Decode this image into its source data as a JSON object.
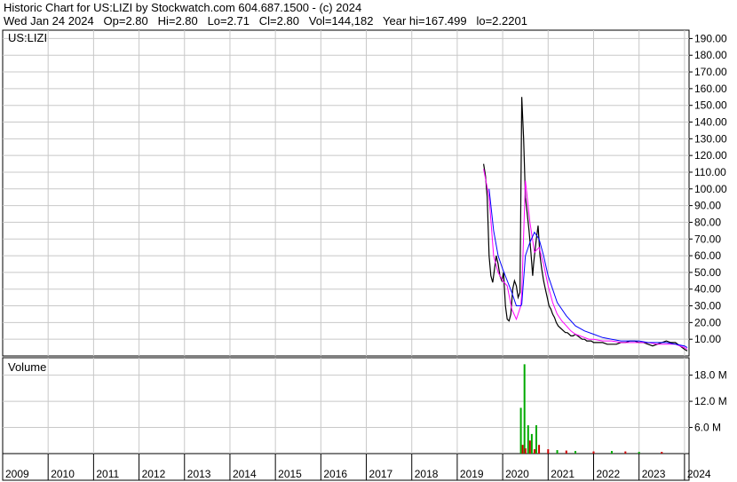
{
  "header": {
    "line1": "Historic Chart for US:LIZI by Stockwatch.com 604.687.1500 - (c) 2024",
    "line2": "Wed Jan 24 2024   Op=2.80   Hi=2.80   Lo=2.71   Cl=2.80   Vol=144,182   Year hi=167.499   lo=2.2201"
  },
  "chart_data": [
    {
      "type": "line",
      "symbol_label": "US:LIZI",
      "x_label": "",
      "y_label": "",
      "ylim": [
        0,
        195
      ],
      "yticks": [
        10,
        20,
        30,
        40,
        50,
        60,
        70,
        80,
        90,
        100,
        110,
        120,
        130,
        140,
        150,
        160,
        170,
        180,
        190
      ],
      "ytick_labels": [
        "10.00",
        "20.00",
        "30.00",
        "40.00",
        "50.00",
        "60.00",
        "70.00",
        "80.00",
        "90.00",
        "100.00",
        "110.00",
        "120.00",
        "130.00",
        "140.00",
        "150.00",
        "160.00",
        "170.00",
        "180.00",
        "190.00"
      ],
      "grid": true,
      "colors": {
        "price": "#000000",
        "ma_short": "#ff00ff",
        "ma_long": "#0000ff"
      },
      "series": [
        {
          "role": "price",
          "x": [
            2019.58,
            2019.62,
            2019.66,
            2019.7,
            2019.74,
            2019.78,
            2019.82,
            2019.86,
            2019.9,
            2019.94,
            2019.98,
            2020.02,
            2020.06,
            2020.1,
            2020.14,
            2020.18,
            2020.22,
            2020.26,
            2020.3,
            2020.34,
            2020.38,
            2020.42,
            2020.46,
            2020.5,
            2020.54,
            2020.58,
            2020.62,
            2020.66,
            2020.68,
            2020.7,
            2020.74,
            2020.78,
            2020.82,
            2020.86,
            2020.9,
            2020.94,
            2020.98,
            2021.02,
            2021.06,
            2021.1,
            2021.14,
            2021.18,
            2021.22,
            2021.26,
            2021.3,
            2021.34,
            2021.38,
            2021.42,
            2021.46,
            2021.5,
            2021.55,
            2021.6,
            2021.65,
            2021.7,
            2021.75,
            2021.8,
            2021.85,
            2021.9,
            2021.95,
            2022.0,
            2022.1,
            2022.2,
            2022.3,
            2022.4,
            2022.5,
            2022.6,
            2022.7,
            2022.8,
            2022.9,
            2023.0,
            2023.1,
            2023.2,
            2023.3,
            2023.4,
            2023.5,
            2023.6,
            2023.7,
            2023.8,
            2023.9,
            2024.0,
            2024.06
          ],
          "y": [
            115,
            108,
            95,
            60,
            48,
            44,
            52,
            60,
            55,
            48,
            45,
            50,
            30,
            22,
            21,
            25,
            40,
            45,
            42,
            35,
            38,
            155,
            130,
            95,
            85,
            75,
            62,
            48,
            55,
            60,
            70,
            78,
            60,
            52,
            45,
            40,
            35,
            30,
            28,
            25,
            23,
            20,
            18,
            17,
            16,
            15,
            14,
            14,
            13,
            12,
            12,
            13,
            12,
            11,
            10,
            10,
            9,
            9,
            9,
            8,
            8,
            8,
            7,
            7,
            7,
            8,
            8,
            9,
            9,
            8,
            8,
            7,
            6,
            7,
            8,
            9,
            8,
            8,
            6,
            4,
            3
          ]
        },
        {
          "role": "ma_short",
          "x": [
            2019.58,
            2019.7,
            2019.8,
            2019.9,
            2020.0,
            2020.1,
            2020.2,
            2020.3,
            2020.4,
            2020.42,
            2020.5,
            2020.6,
            2020.7,
            2020.8,
            2020.9,
            2021.0,
            2021.1,
            2021.2,
            2021.3,
            2021.4,
            2021.5,
            2021.6,
            2021.7,
            2021.8,
            2021.9,
            2022.0,
            2022.2,
            2022.4,
            2022.6,
            2022.8,
            2023.0,
            2023.2,
            2023.4,
            2023.6,
            2023.8,
            2024.0,
            2024.06
          ],
          "y": [
            112,
            95,
            60,
            50,
            45,
            42,
            28,
            22,
            30,
            38,
            105,
            80,
            62,
            65,
            55,
            42,
            32,
            25,
            21,
            18,
            15,
            13,
            12,
            11,
            10,
            10,
            9,
            9,
            8,
            8,
            8,
            8,
            7,
            7,
            7,
            5,
            4
          ]
        },
        {
          "role": "ma_long",
          "x": [
            2019.7,
            2019.8,
            2019.9,
            2020.0,
            2020.2,
            2020.3,
            2020.4,
            2020.42,
            2020.5,
            2020.6,
            2020.7,
            2020.8,
            2020.9,
            2021.0,
            2021.2,
            2021.4,
            2021.6,
            2021.8,
            2022.0,
            2022.2,
            2022.4,
            2022.6,
            2022.8,
            2023.0,
            2023.2,
            2023.4,
            2023.6,
            2023.8,
            2024.0,
            2024.06
          ],
          "y": [
            100,
            75,
            60,
            52,
            38,
            30,
            30,
            31,
            60,
            68,
            74,
            70,
            60,
            48,
            32,
            24,
            18,
            15,
            13,
            11,
            10,
            9,
            9,
            9,
            8,
            8,
            8,
            7,
            6,
            5
          ]
        }
      ]
    },
    {
      "type": "bar",
      "panel_label": "Volume",
      "ylim": [
        0,
        22
      ],
      "yticks": [
        6,
        12,
        18
      ],
      "ytick_labels": [
        "6.0 M",
        "12.0 M",
        "18.0 M"
      ],
      "grid": true,
      "colors": {
        "up": "#00aa00",
        "down": "#cc0000"
      },
      "x": [
        2020.4,
        2020.44,
        2020.48,
        2020.5,
        2020.56,
        2020.6,
        2020.64,
        2020.7,
        2020.74,
        2020.8,
        2021.0,
        2021.2,
        2021.4,
        2021.6,
        2022.0,
        2022.4,
        2022.7,
        2023.0,
        2023.5
      ],
      "values": [
        10.5,
        2.0,
        20.5,
        1.2,
        6.5,
        3.0,
        4.5,
        1.0,
        6.5,
        2.0,
        1.0,
        0.8,
        0.7,
        0.6,
        0.5,
        0.6,
        0.5,
        0.4,
        0.4
      ],
      "directions": [
        "up",
        "down",
        "up",
        "down",
        "up",
        "down",
        "up",
        "down",
        "up",
        "down",
        "down",
        "up",
        "down",
        "up",
        "down",
        "up",
        "down",
        "up",
        "down"
      ]
    }
  ],
  "x_axis": {
    "xlim": [
      2009.0,
      2024.1
    ],
    "labels": [
      "2009",
      "2010",
      "2011",
      "2012",
      "2013",
      "2014",
      "2015",
      "2016",
      "2017",
      "2018",
      "2019",
      "2020",
      "2021",
      "2022",
      "2023",
      "2024"
    ],
    "label_positions": [
      2009,
      2010,
      2011,
      2012,
      2013,
      2014,
      2015,
      2016,
      2017,
      2018,
      2019,
      2020,
      2021,
      2022,
      2023,
      2024
    ]
  }
}
